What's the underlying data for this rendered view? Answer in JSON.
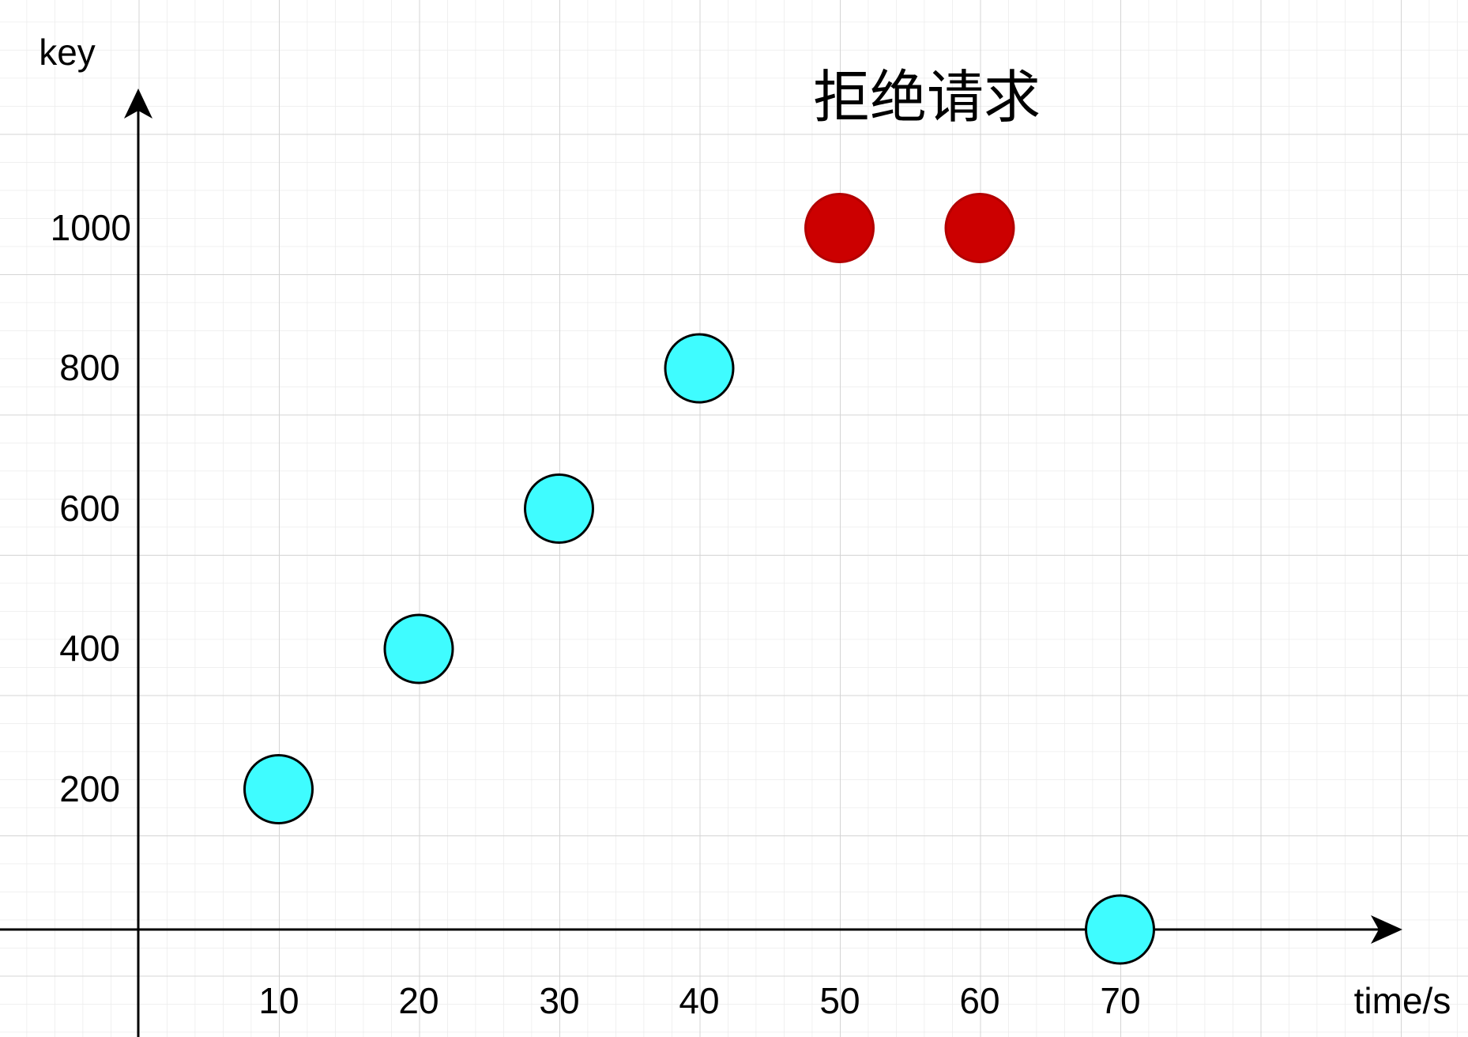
{
  "chart_data": {
    "type": "scatter",
    "xlabel": "time/s",
    "ylabel": "key",
    "annotations": [
      {
        "text": "拒绝请求",
        "x": 56,
        "y": 1180
      }
    ],
    "x_ticks": [
      "10",
      "20",
      "30",
      "40",
      "50",
      "60",
      "70"
    ],
    "y_ticks": [
      "200",
      "400",
      "600",
      "800",
      "1000"
    ],
    "xlim": [
      -10,
      90
    ],
    "ylim": [
      -150,
      1500
    ],
    "grid": true,
    "series": [
      {
        "color": "#3ffcff",
        "stroke": "#000000",
        "points": [
          {
            "x": 10,
            "y": 200
          },
          {
            "x": 20,
            "y": 400
          },
          {
            "x": 30,
            "y": 600
          },
          {
            "x": 40,
            "y": 800
          },
          {
            "x": 70,
            "y": 0
          }
        ]
      },
      {
        "color": "#cc0000",
        "stroke": "#b30000",
        "points": [
          {
            "x": 50,
            "y": 1000
          },
          {
            "x": 60,
            "y": 1000
          }
        ]
      }
    ]
  }
}
